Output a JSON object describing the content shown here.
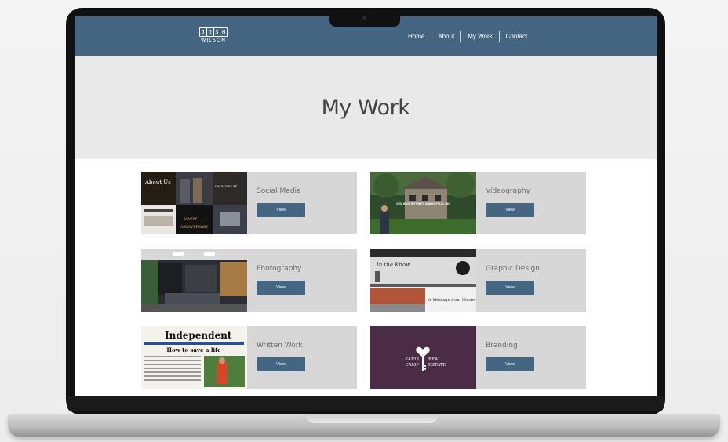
{
  "site": {
    "logo_letters": [
      "J",
      "O",
      "S",
      "H"
    ],
    "logo_surname": "WILSON",
    "nav": [
      "Home",
      "About",
      "My Work",
      "Contact"
    ]
  },
  "hero": {
    "title": "My Work"
  },
  "cards": [
    {
      "title": "Social Media",
      "button": "View",
      "thumb_text": [
        "About Us",
        "DAY IN THE LIFE",
        "HAPPY",
        "ANNIVERSARY"
      ]
    },
    {
      "title": "Videography",
      "button": "View",
      "thumb_text": [
        "2352 W 24TH STREET, MINNEAPOLIS, MN"
      ]
    },
    {
      "title": "Photography",
      "button": "View",
      "thumb_text": []
    },
    {
      "title": "Graphic Design",
      "button": "View",
      "thumb_text": [
        "In the Know",
        "A Message from Nicole"
      ]
    },
    {
      "title": "Written Work",
      "button": "View",
      "thumb_text": [
        "Independent",
        "How to save a life"
      ]
    },
    {
      "title": "Branding",
      "button": "View",
      "thumb_text": [
        "KARLI",
        "CAMP",
        "REAL",
        "ESTATE"
      ]
    }
  ],
  "colors": {
    "brand": "#446682",
    "card": "#d7d7d7",
    "hero": "#e9e9e9",
    "branding_bg": "#4a2c46"
  },
  "icons": {
    "logo": "josh-wilson-logo",
    "branding_mark": "heart-key-icon"
  }
}
